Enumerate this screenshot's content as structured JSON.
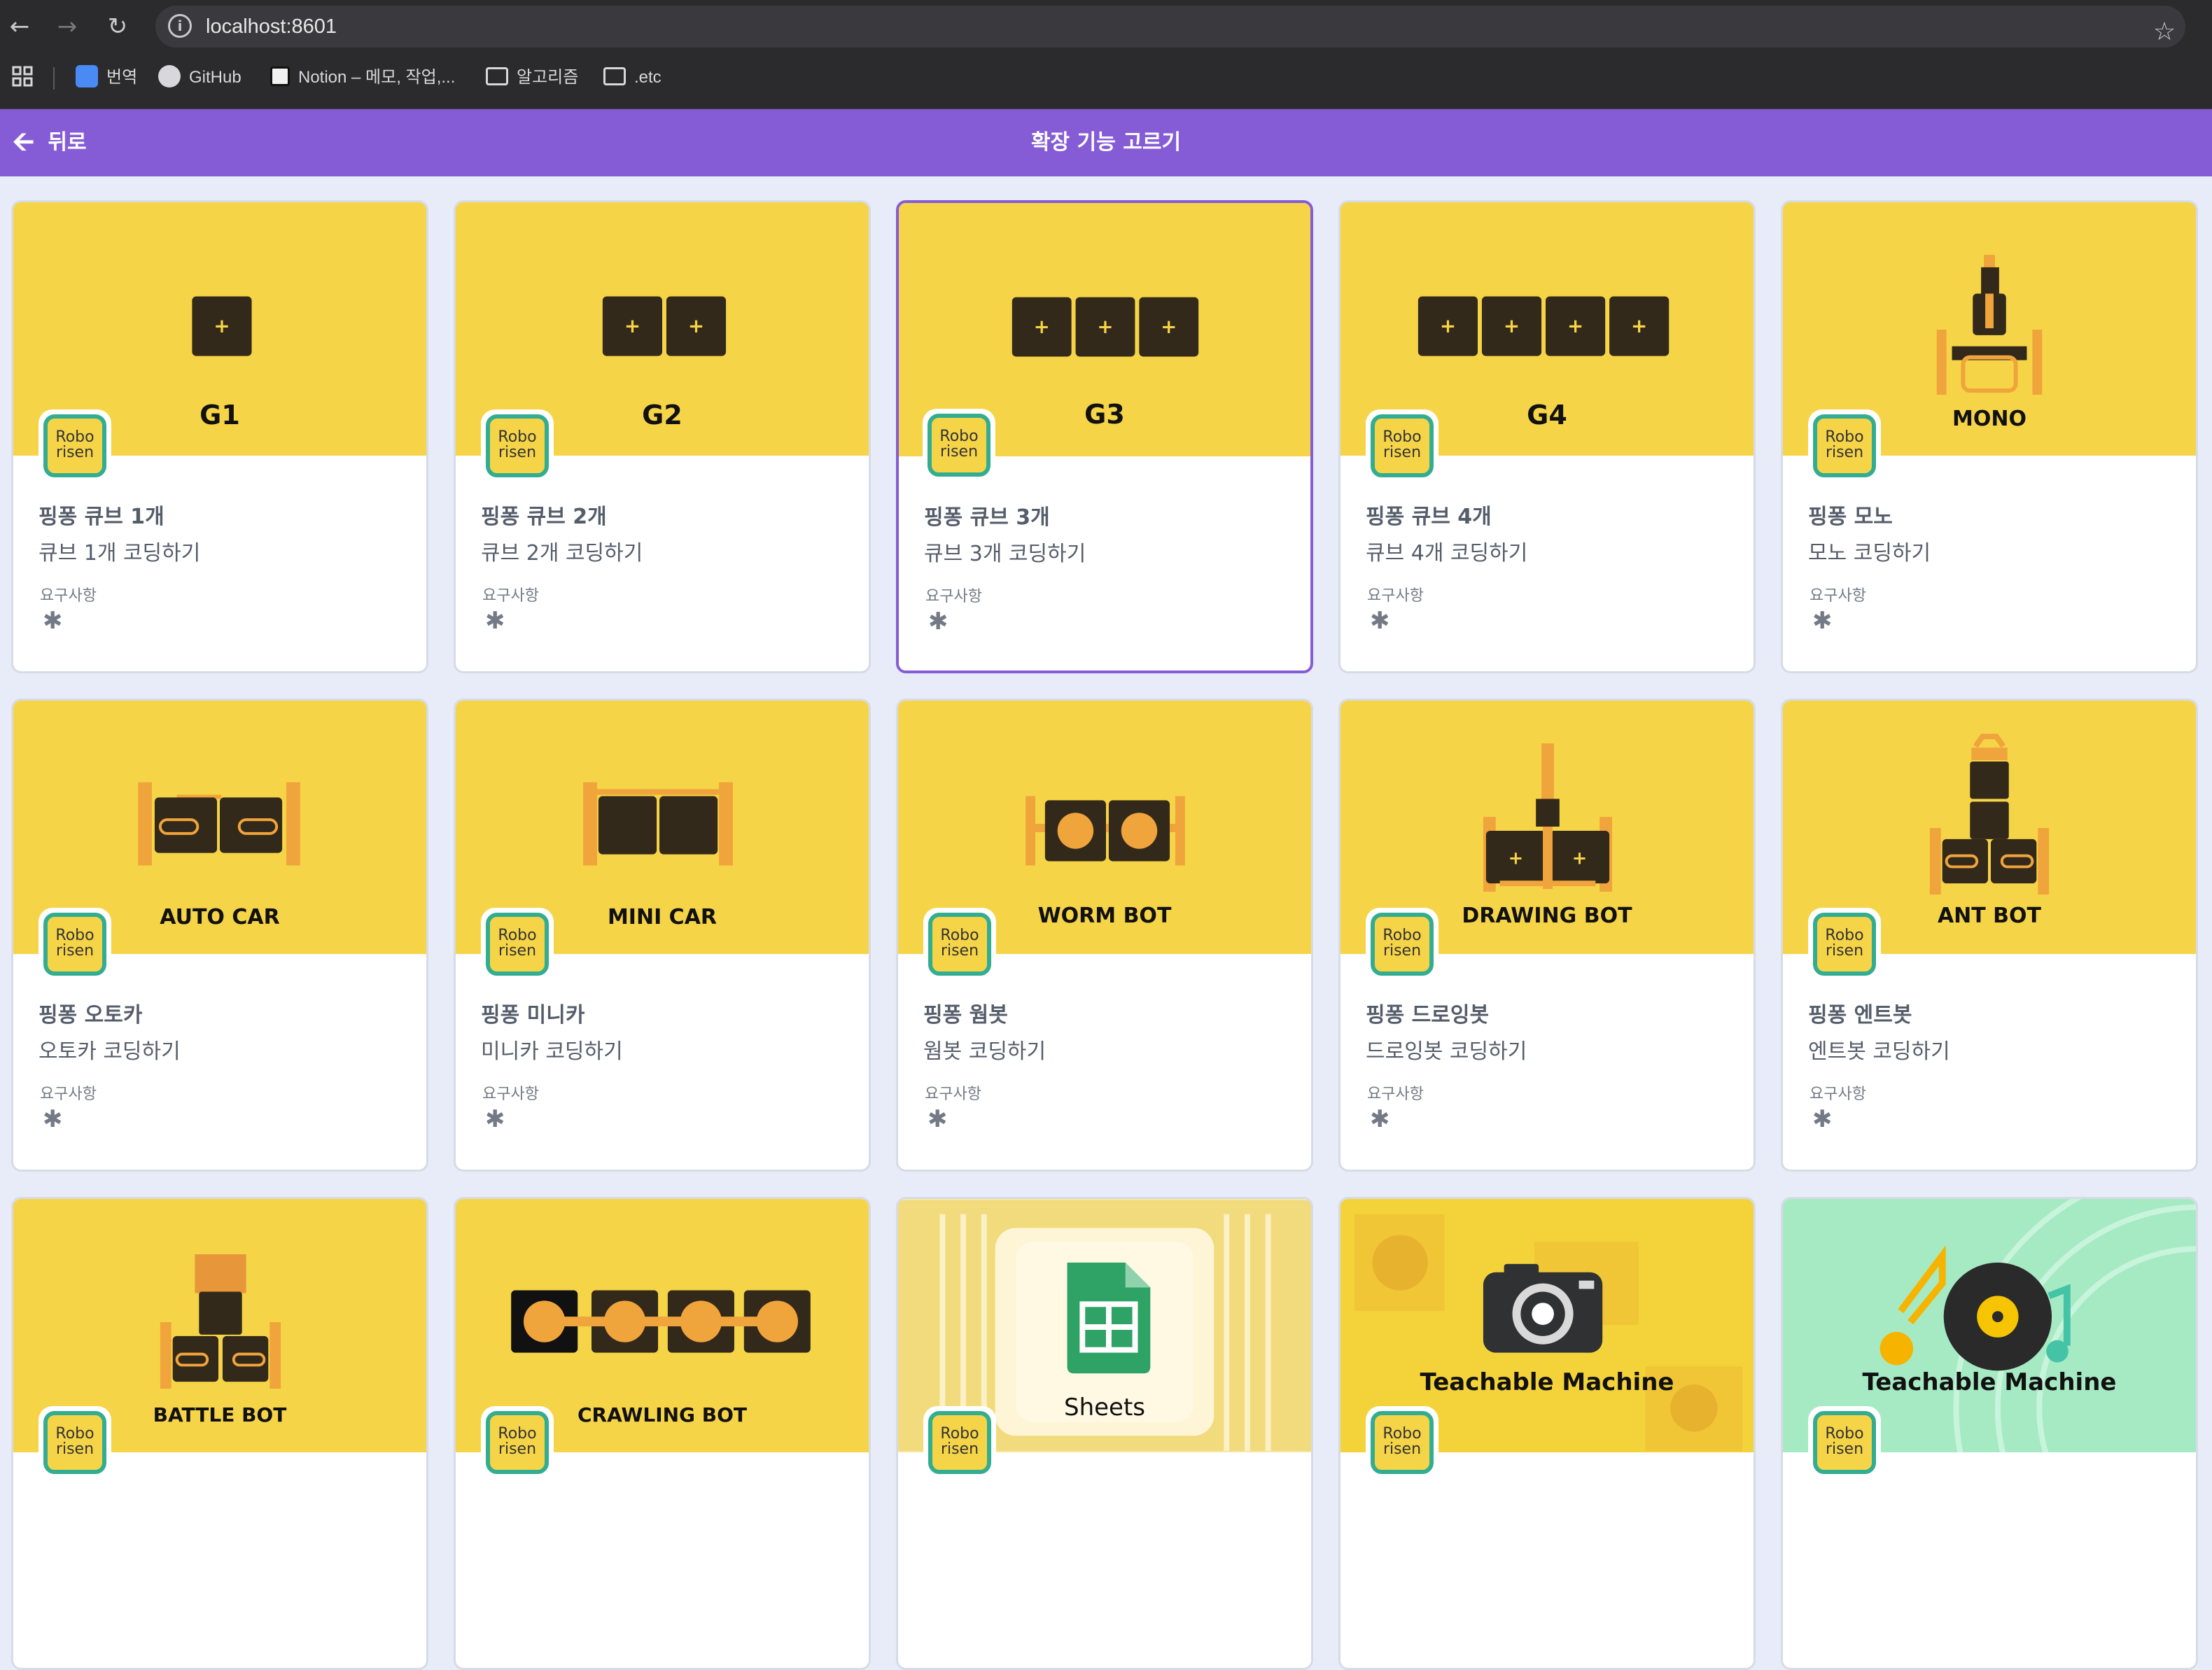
{
  "browser": {
    "url": "localhost:8601",
    "bookmarks": [
      "번역",
      "GitHub",
      "Notion – 메모, 작업,...",
      "알고리즘",
      ".etc"
    ]
  },
  "appbar": {
    "back_label": "뒤로",
    "title": "확장 기능 고르기"
  },
  "cards": [
    {
      "hero_label": "G1",
      "badge": "Robo risen",
      "title": "핑퐁 큐브 1개",
      "description": "큐브 1개 코딩하기",
      "requirements_label": "요구사항",
      "requirement_icon": "bluetooth-icon"
    },
    {
      "hero_label": "G2",
      "badge": "Robo risen",
      "title": "핑퐁 큐브 2개",
      "description": "큐브 2개 코딩하기",
      "requirements_label": "요구사항",
      "requirement_icon": "bluetooth-icon"
    },
    {
      "hero_label": "G3",
      "badge": "Robo risen",
      "title": "핑퐁 큐브 3개",
      "description": "큐브 3개 코딩하기",
      "requirements_label": "요구사항",
      "requirement_icon": "bluetooth-icon",
      "selected": true
    },
    {
      "hero_label": "G4",
      "badge": "Robo risen",
      "title": "핑퐁 큐브 4개",
      "description": "큐브 4개 코딩하기",
      "requirements_label": "요구사항",
      "requirement_icon": "bluetooth-icon"
    },
    {
      "hero_label": "MONO",
      "badge": "Robo risen",
      "title": "핑퐁 모노",
      "description": "모노 코딩하기",
      "requirements_label": "요구사항",
      "requirement_icon": "bluetooth-icon"
    },
    {
      "hero_label": "AUTO CAR",
      "badge": "Robo risen",
      "title": "핑퐁 오토카",
      "description": "오토카 코딩하기",
      "requirements_label": "요구사항",
      "requirement_icon": "bluetooth-icon"
    },
    {
      "hero_label": "MINI CAR",
      "badge": "Robo risen",
      "title": "핑퐁 미니카",
      "description": "미니카 코딩하기",
      "requirements_label": "요구사항",
      "requirement_icon": "bluetooth-icon"
    },
    {
      "hero_label": "WORM BOT",
      "badge": "Robo risen",
      "title": "핑퐁 웜봇",
      "description": "웜봇 코딩하기",
      "requirements_label": "요구사항",
      "requirement_icon": "bluetooth-icon"
    },
    {
      "hero_label": "DRAWING BOT",
      "badge": "Robo risen",
      "title": "핑퐁 드로잉봇",
      "description": "드로잉봇 코딩하기",
      "requirements_label": "요구사항",
      "requirement_icon": "bluetooth-icon"
    },
    {
      "hero_label": "ANT BOT",
      "badge": "Robo risen",
      "title": "핑퐁 엔트봇",
      "description": "엔트봇 코딩하기",
      "requirements_label": "요구사항",
      "requirement_icon": "bluetooth-icon"
    },
    {
      "hero_label": "BATTLE BOT",
      "badge": "Robo risen"
    },
    {
      "hero_label": "CRAWLING BOT",
      "badge": "Robo risen"
    },
    {
      "hero_label": "Sheets",
      "badge": "Robo risen"
    },
    {
      "hero_label": "Teachable Machine",
      "badge": "Robo risen"
    },
    {
      "hero_label": "Teachable Machine",
      "badge": "Robo risen"
    }
  ],
  "colors": {
    "accent": "#855cd6",
    "card_hero": "#f6d447",
    "robot_dark": "#33291a",
    "robot_orange": "#f0a43c",
    "badge_border": "#32ad91"
  }
}
